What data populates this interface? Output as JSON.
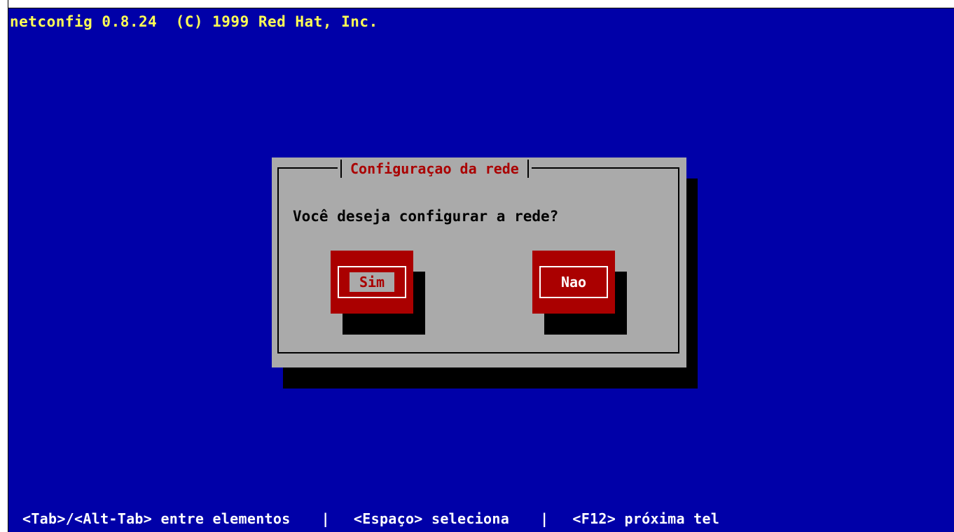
{
  "header": {
    "title": "netconfig 0.8.24  (C) 1999 Red Hat, Inc."
  },
  "dialog": {
    "title": "Configuraçao da rede",
    "question": "Você deseja configurar a rede?",
    "buttons": {
      "yes_label": "Sim",
      "no_label": "Nao",
      "focused": "Sim"
    }
  },
  "status_bar": {
    "hint_tab": "<Tab>/<Alt-Tab> entre elementos",
    "separator": "|",
    "hint_space": "<Espaço> seleciona",
    "hint_f12": "<F12> próxima tel"
  },
  "colors": {
    "background": "#0000a8",
    "title_text": "#ffff55",
    "dialog_bg": "#aaaaaa",
    "dialog_title": "#aa0000",
    "button_bg": "#aa0000",
    "status_text": "#ffffff"
  }
}
